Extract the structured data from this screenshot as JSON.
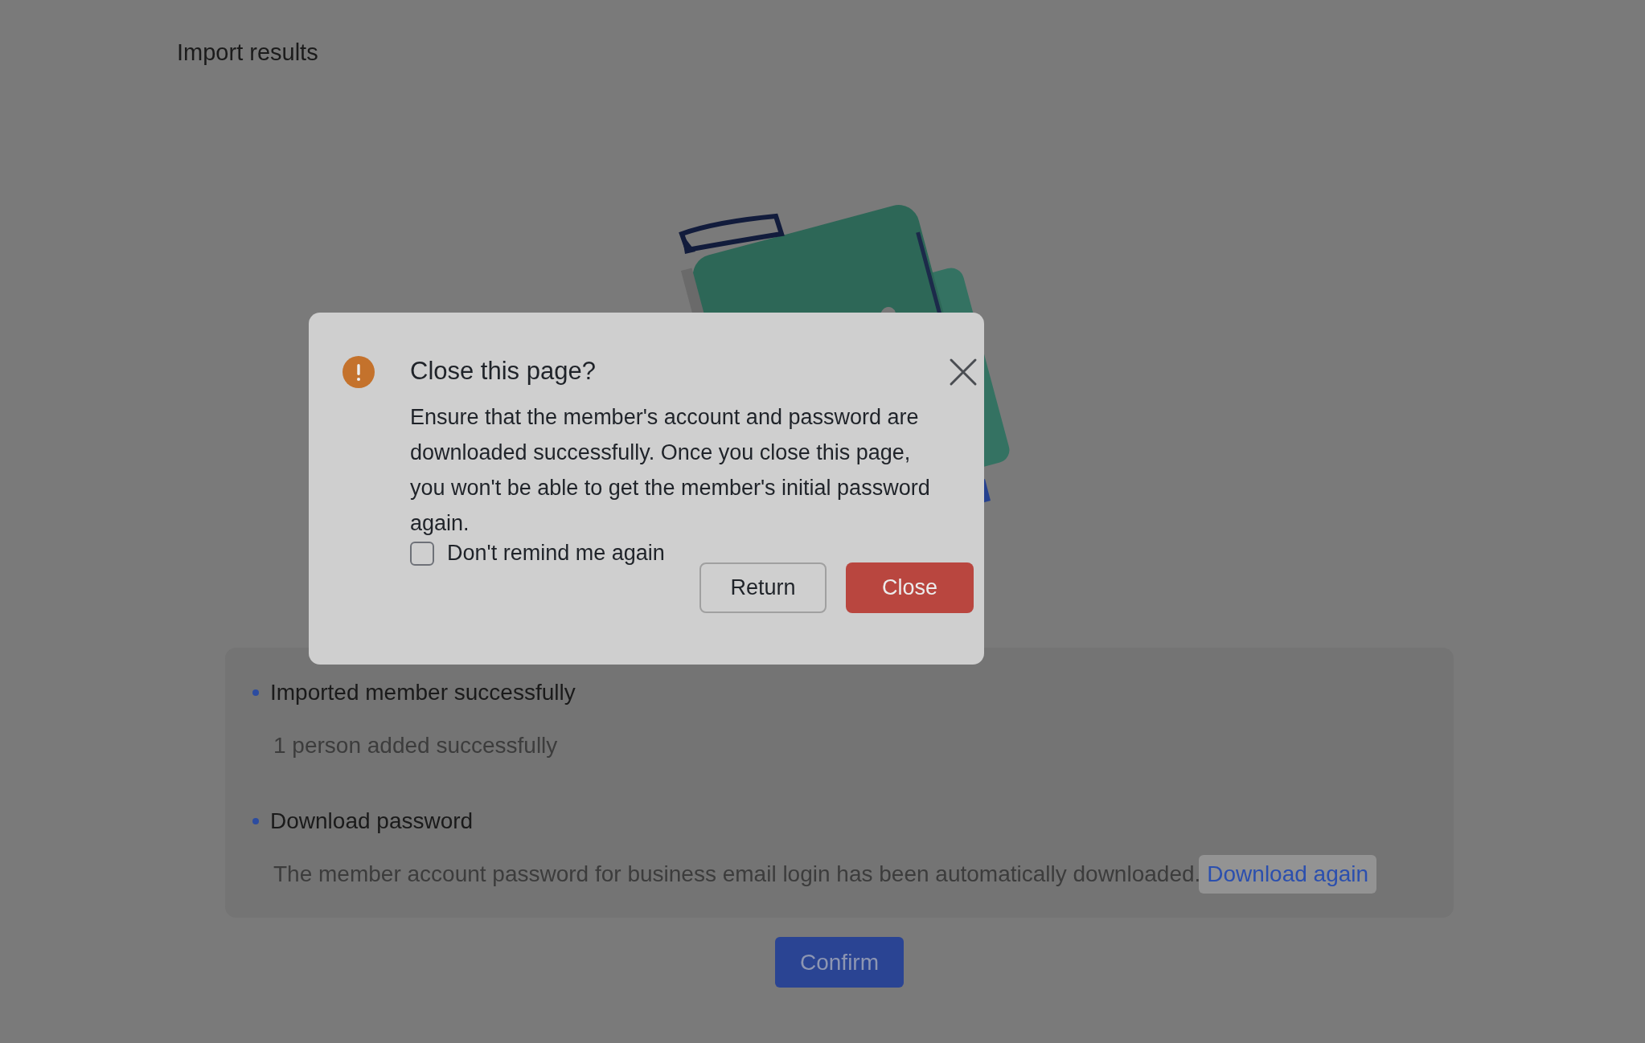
{
  "page": {
    "title": "Import results"
  },
  "results": [
    {
      "heading": "Imported member successfully",
      "detail": "1 person added successfully"
    },
    {
      "heading": "Download password",
      "detail": "The member account password for business email login has been automatically downloaded.",
      "link": "Download again"
    }
  ],
  "confirm_button": "Confirm",
  "dialog": {
    "title": "Close this page?",
    "message": "Ensure that the member's account and password are downloaded successfully. Once you close this page, you won't be able to get the member's initial password again.",
    "checkbox": {
      "label": "Don't remind me again",
      "checked": false
    },
    "buttons": [
      {
        "label": "Return",
        "kind": "secondary"
      },
      {
        "label": "Close",
        "kind": "danger"
      }
    ]
  }
}
